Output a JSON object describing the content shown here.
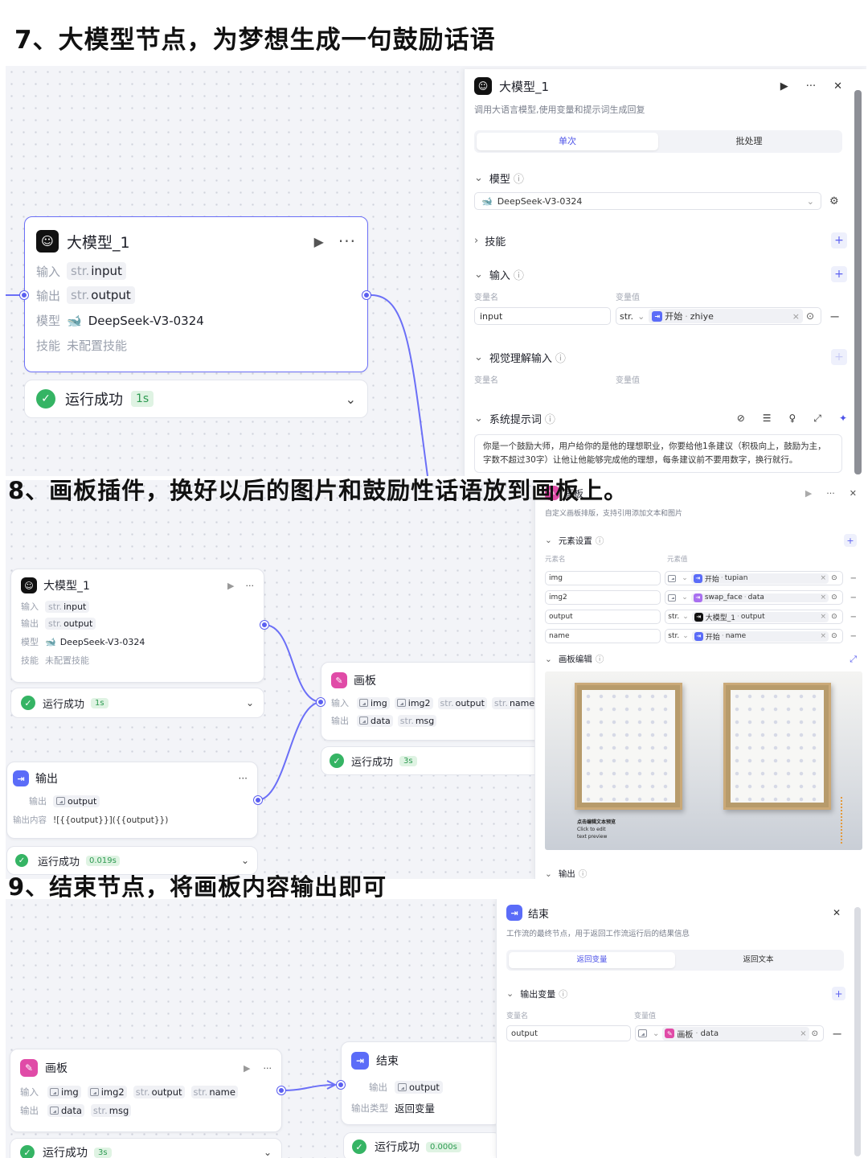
{
  "headings": {
    "step7": "7、大模型节点，为梦想生成一句鼓励话语",
    "step8": "8、画板插件，换好以后的图片和鼓励性话语放到画板上。",
    "step9": "9、结束节点，将画板内容输出即可"
  },
  "section7": {
    "llm_node": {
      "title": "大模型_1",
      "input_key": "输入",
      "input_type": "str.",
      "input_name": "input",
      "output_key": "输出",
      "output_type": "str.",
      "output_name": "output",
      "model_key": "模型",
      "model_name": "DeepSeek-V3-0324",
      "skill_key": "技能",
      "skill_value": "未配置技能",
      "status": "运行成功",
      "time": "1s"
    },
    "panel": {
      "title": "大模型_1",
      "desc": "调用大语言模型,使用变量和提示词生成回复",
      "tab_single": "单次",
      "tab_batch": "批处理",
      "model_label": "模型",
      "model_value": "DeepSeek-V3-0324",
      "skills_label": "技能",
      "input_label": "输入",
      "var_name_label": "变量名",
      "var_value_label": "变量值",
      "input_var": "input",
      "input_type": "str.",
      "ref_source": "开始",
      "ref_var": "zhiye",
      "vision_label": "视觉理解输入",
      "vision_var_name": "变量名",
      "vision_var_value": "变量值",
      "sysprompt_label": "系统提示词",
      "sysprompt_text": "你是一个鼓励大师，用户给你的是他的理想职业，你要给他1条建议（积极向上，鼓励为主，字数不超过30字）让他让他能够完成他的理想，每条建议前不要用数字，换行就行。"
    }
  },
  "section8": {
    "llm_node": {
      "title": "大模型_1",
      "input_key": "输入",
      "input_type": "str.",
      "input_name": "input",
      "output_key": "输出",
      "output_type": "str.",
      "output_name": "output",
      "model_key": "模型",
      "model_name": "DeepSeek-V3-0324",
      "skill_key": "技能",
      "skill_value": "未配置技能",
      "status": "运行成功",
      "time": "1s"
    },
    "output_node": {
      "title": "输出",
      "out_key": "输出",
      "out_name": "output",
      "content_key": "输出内容",
      "content_value": "![{{output}}]({{output}})",
      "status": "运行成功",
      "time": "0.019s"
    },
    "board_node": {
      "title": "画板",
      "input_key": "输入",
      "in1": "img",
      "in2": "img2",
      "in3_type": "str.",
      "in3": "output",
      "in4_type": "str.",
      "in4": "name",
      "output_key": "输出",
      "out1": "data",
      "out2_type": "str.",
      "out2": "msg",
      "status": "运行成功",
      "time": "3s"
    },
    "panel": {
      "title": "画板",
      "desc": "自定义画板排版，支持引用添加文本和图片",
      "elements_label": "元素设置",
      "el_name_label": "元素名",
      "el_value_label": "元素值",
      "rows": [
        {
          "name": "img",
          "type": "img",
          "src": "开始",
          "var": "tupian",
          "src_color": "#5b6cf8"
        },
        {
          "name": "img2",
          "type": "img",
          "src": "swap_face",
          "var": "data",
          "src_color": "#a970f0"
        },
        {
          "name": "output",
          "type": "str.",
          "src": "大模型_1",
          "var": "output",
          "src_color": "#111111"
        },
        {
          "name": "name",
          "type": "str.",
          "src": "开始",
          "var": "name",
          "src_color": "#5b6cf8"
        }
      ],
      "edit_label": "画板编辑",
      "preview_text_1": "点击编辑文本预览",
      "preview_text_2": "Click to edit",
      "preview_text_3": "text preview",
      "output_label": "输出"
    }
  },
  "section9": {
    "board_node": {
      "title": "画板",
      "input_key": "输入",
      "in1": "img",
      "in2": "img2",
      "in3_type": "str.",
      "in3": "output",
      "in4_type": "str.",
      "in4": "name",
      "output_key": "输出",
      "out1": "data",
      "out2_type": "str.",
      "out2": "msg",
      "status": "运行成功",
      "time": "3s"
    },
    "end_node": {
      "title": "结束",
      "out_key": "输出",
      "out_name": "output",
      "type_key": "输出类型",
      "type_value": "返回变量",
      "status": "运行成功",
      "time": "0.000s"
    },
    "panel": {
      "title": "结束",
      "desc": "工作流的最终节点，用于返回工作流运行后的结果信息",
      "tab_var": "返回变量",
      "tab_text": "返回文本",
      "outvars_label": "输出变量",
      "var_name_label": "变量名",
      "var_value_label": "变量值",
      "var": "output",
      "ref_source": "画板",
      "ref_var": "data"
    }
  },
  "colors": {
    "accent": "#5b5ff0",
    "success": "#35b464",
    "board": "#e04ba7"
  }
}
